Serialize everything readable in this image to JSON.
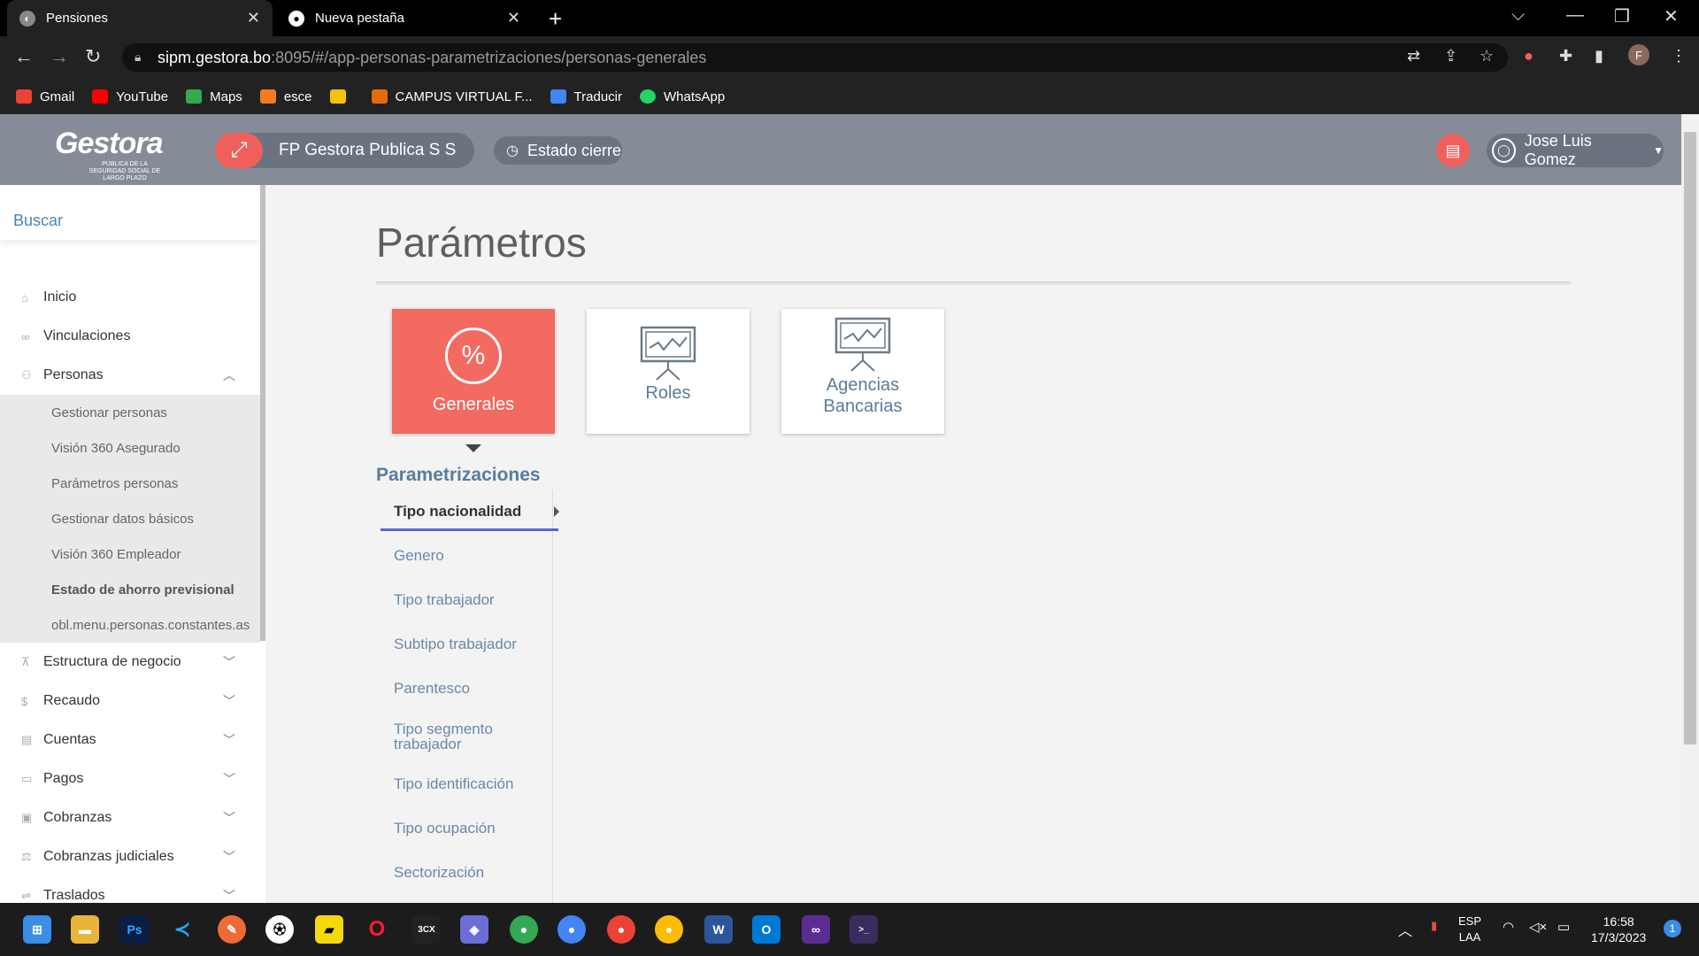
{
  "browser": {
    "tabs": [
      {
        "title": "Pensiones",
        "close": "✕"
      },
      {
        "title": "Nueva pestaña",
        "close": "✕"
      }
    ],
    "new_tab": "+",
    "url_host": "sipm.gestora.bo",
    "url_rest": ":8095/#/app-personas-parametrizaciones/personas-generales",
    "profile_letter": "F",
    "bookmarks": [
      {
        "label": "Gmail",
        "color": "#ea4335"
      },
      {
        "label": "YouTube",
        "color": "#ff0000"
      },
      {
        "label": "Maps",
        "color": "#34a853"
      },
      {
        "label": "esce",
        "color": "#f47b20"
      },
      {
        "label": "",
        "color": "#f5c400"
      },
      {
        "label": "CAMPUS VIRTUAL F...",
        "color": "#e36c0a"
      },
      {
        "label": "Traducir",
        "color": "#4285f4"
      },
      {
        "label": "WhatsApp",
        "color": "#25d366"
      }
    ]
  },
  "app": {
    "logo": "Gestora",
    "logo_sub": "PÚBLICA DE LA SEGURIDAD SOCIAL DE LARGO PLAZO",
    "entity": "FP Gestora Publica S S",
    "estado_cierre": "Estado cierre",
    "user": "Jose Luis Gomez",
    "accent": "#f0605a"
  },
  "sidebar": {
    "search": "Buscar",
    "items": [
      {
        "label": "Inicio",
        "icon": "home-icon"
      },
      {
        "label": "Vinculaciones",
        "icon": "link-icon"
      },
      {
        "label": "Personas",
        "icon": "people-icon"
      }
    ],
    "personas_sub": [
      "Gestionar personas",
      "Visión 360 Asegurado",
      "Parámetros personas",
      "Gestionar datos básicos",
      "Visión 360 Empleador",
      "Estado de ahorro previsional",
      "obl.menu.personas.constantes.as"
    ],
    "more_items": [
      {
        "label": "Estructura  de  negocio",
        "icon": "org-icon"
      },
      {
        "label": "Recaudo",
        "icon": "coin-icon"
      },
      {
        "label": "Cuentas",
        "icon": "ledger-icon"
      },
      {
        "label": "Pagos",
        "icon": "card-icon"
      },
      {
        "label": "Cobranzas",
        "icon": "briefcase-icon"
      },
      {
        "label": "Cobranzas  judiciales",
        "icon": "gavel-icon"
      },
      {
        "label": "Traslados",
        "icon": "transfer-icon"
      }
    ]
  },
  "main": {
    "title": "Parámetros",
    "cards": [
      {
        "label": "Generales"
      },
      {
        "label": "Roles"
      },
      {
        "label": "Agencias Bancarias"
      }
    ],
    "section": "Parametrizaciones",
    "params": [
      "Tipo nacionalidad",
      "Genero",
      "Tipo trabajador",
      "Subtipo trabajador",
      "Parentesco",
      "Tipo segmento trabajador",
      "Tipo identificación",
      "Tipo ocupación",
      "Sectorización"
    ]
  },
  "taskbar": {
    "lang": "ESP",
    "layout": "LAA",
    "time": "16:58",
    "date": "17/3/2023",
    "notif": "1"
  }
}
